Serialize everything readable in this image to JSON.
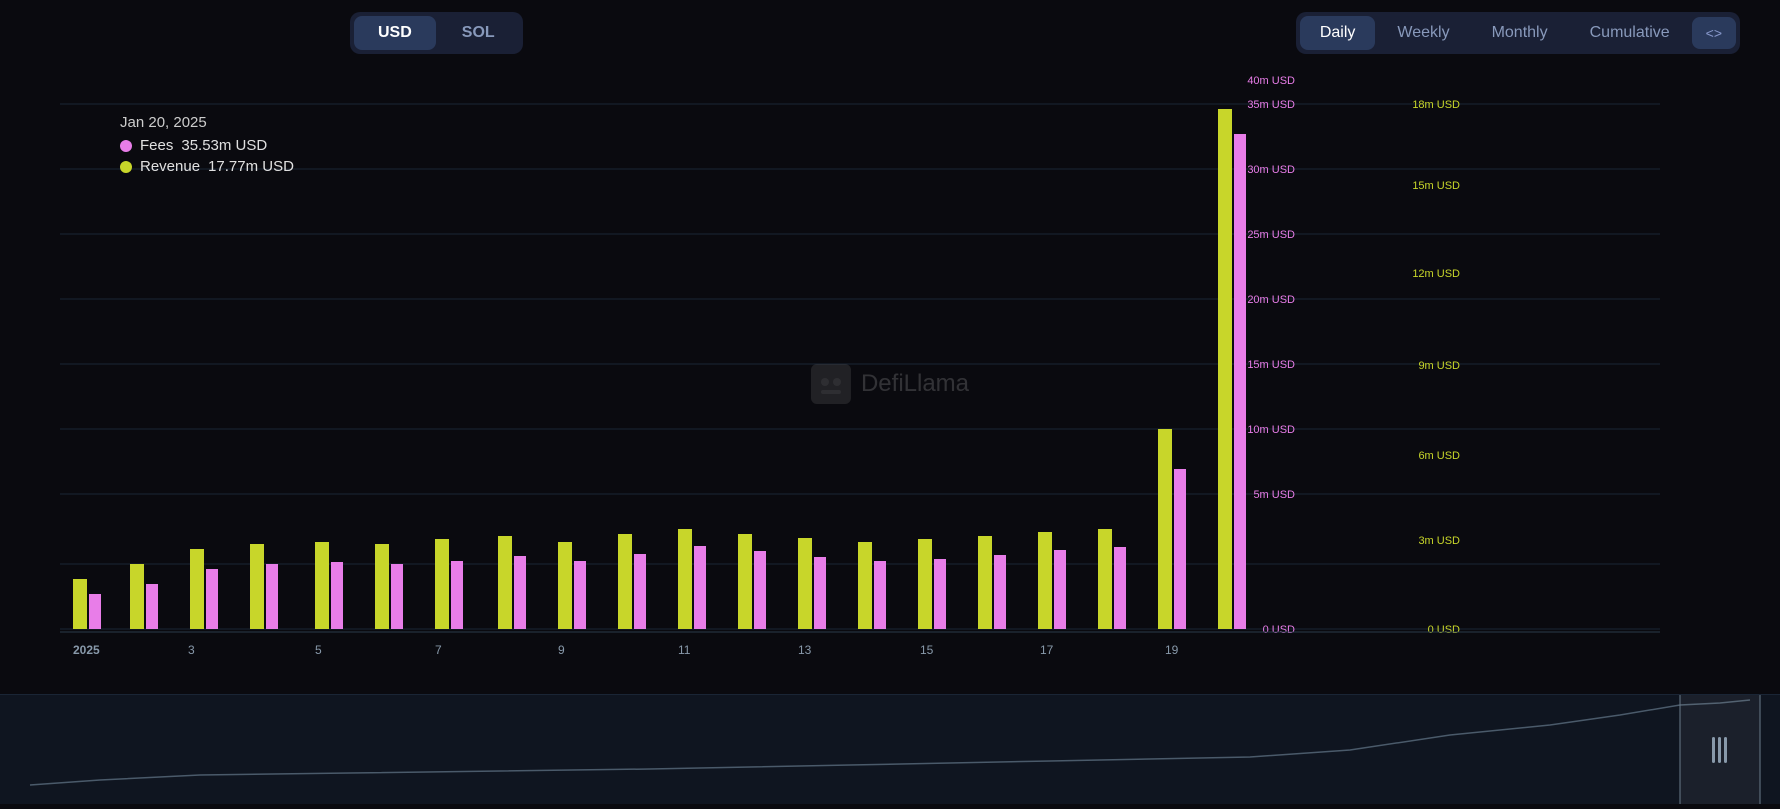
{
  "toolbar": {
    "currency_buttons": [
      {
        "label": "USD",
        "active": true
      },
      {
        "label": "SOL",
        "active": false
      }
    ],
    "period_buttons": [
      {
        "label": "Daily",
        "active": true
      },
      {
        "label": "Weekly",
        "active": false
      },
      {
        "label": "Monthly",
        "active": false
      },
      {
        "label": "Cumulative",
        "active": false
      }
    ],
    "embed_button_label": "<>"
  },
  "tooltip": {
    "date": "Jan 20, 2025",
    "fees_label": "Fees",
    "fees_value": "35.53m USD",
    "revenue_label": "Revenue",
    "revenue_value": "17.77m USD"
  },
  "chart": {
    "watermark": "DefiLlama",
    "x_labels": [
      "2025",
      "3",
      "5",
      "7",
      "9",
      "11",
      "13",
      "15",
      "17",
      "19"
    ],
    "y_labels_left": [
      "40m USD",
      "35m USD",
      "30m USD",
      "25m USD",
      "20m USD",
      "15m USD",
      "10m USD",
      "5m USD",
      "0 USD"
    ],
    "y_labels_right": [
      "18m USD",
      "15m USD",
      "12m USD",
      "9m USD",
      "6m USD",
      "3m USD",
      "0 USD"
    ],
    "colors": {
      "fees": "#e87de8",
      "revenue": "#c8d62a",
      "grid": "#1a2535",
      "axis": "#2a3a4a"
    }
  },
  "navigator": {
    "aria_label": "Chart range navigator"
  }
}
